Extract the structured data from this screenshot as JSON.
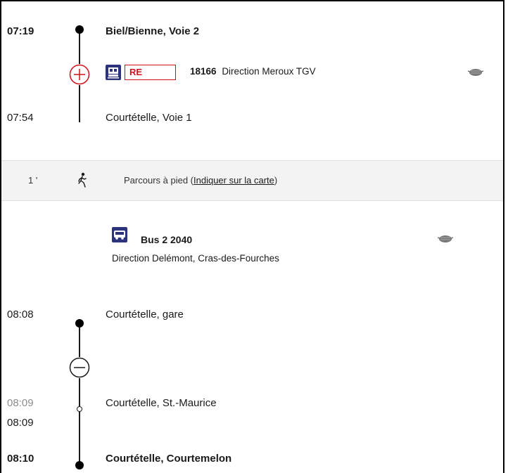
{
  "leg1": {
    "dep_time": "07:19",
    "dep_stop": "Biel/Bienne, Voie 2",
    "product": "RE",
    "train_number": "18166",
    "direction": "Direction Meroux TGV",
    "arr_time": "07:54",
    "arr_stop": "Courtételle, Voie 1",
    "icons": {
      "train": "train-icon",
      "mask": "mask-icon",
      "expand": "plus-circle-icon"
    }
  },
  "walk": {
    "duration": "1 '",
    "text": "Parcours à pied (",
    "link": "Indiquer sur la carte",
    "text_end": ")",
    "icon": "walk-icon"
  },
  "leg2": {
    "line": "Bus 2 2040",
    "direction": "Direction Delémont, Cras-des-Fourches",
    "icons": {
      "bus": "bus-icon",
      "mask": "mask-icon",
      "collapse": "minus-circle-icon"
    },
    "stops": [
      {
        "time": "08:08",
        "name": "Courtételle, gare"
      },
      {
        "time_planned": "08:09",
        "time": "08:09",
        "name": "Courtételle, St.-Maurice"
      },
      {
        "time": "08:10",
        "name": "Courtételle, Courtemelon"
      }
    ]
  },
  "colors": {
    "accent_red": "#d0101a",
    "sbb_blue": "#2d327d",
    "text": "#1a1a1a",
    "walk_bg": "#f3f3f3"
  }
}
